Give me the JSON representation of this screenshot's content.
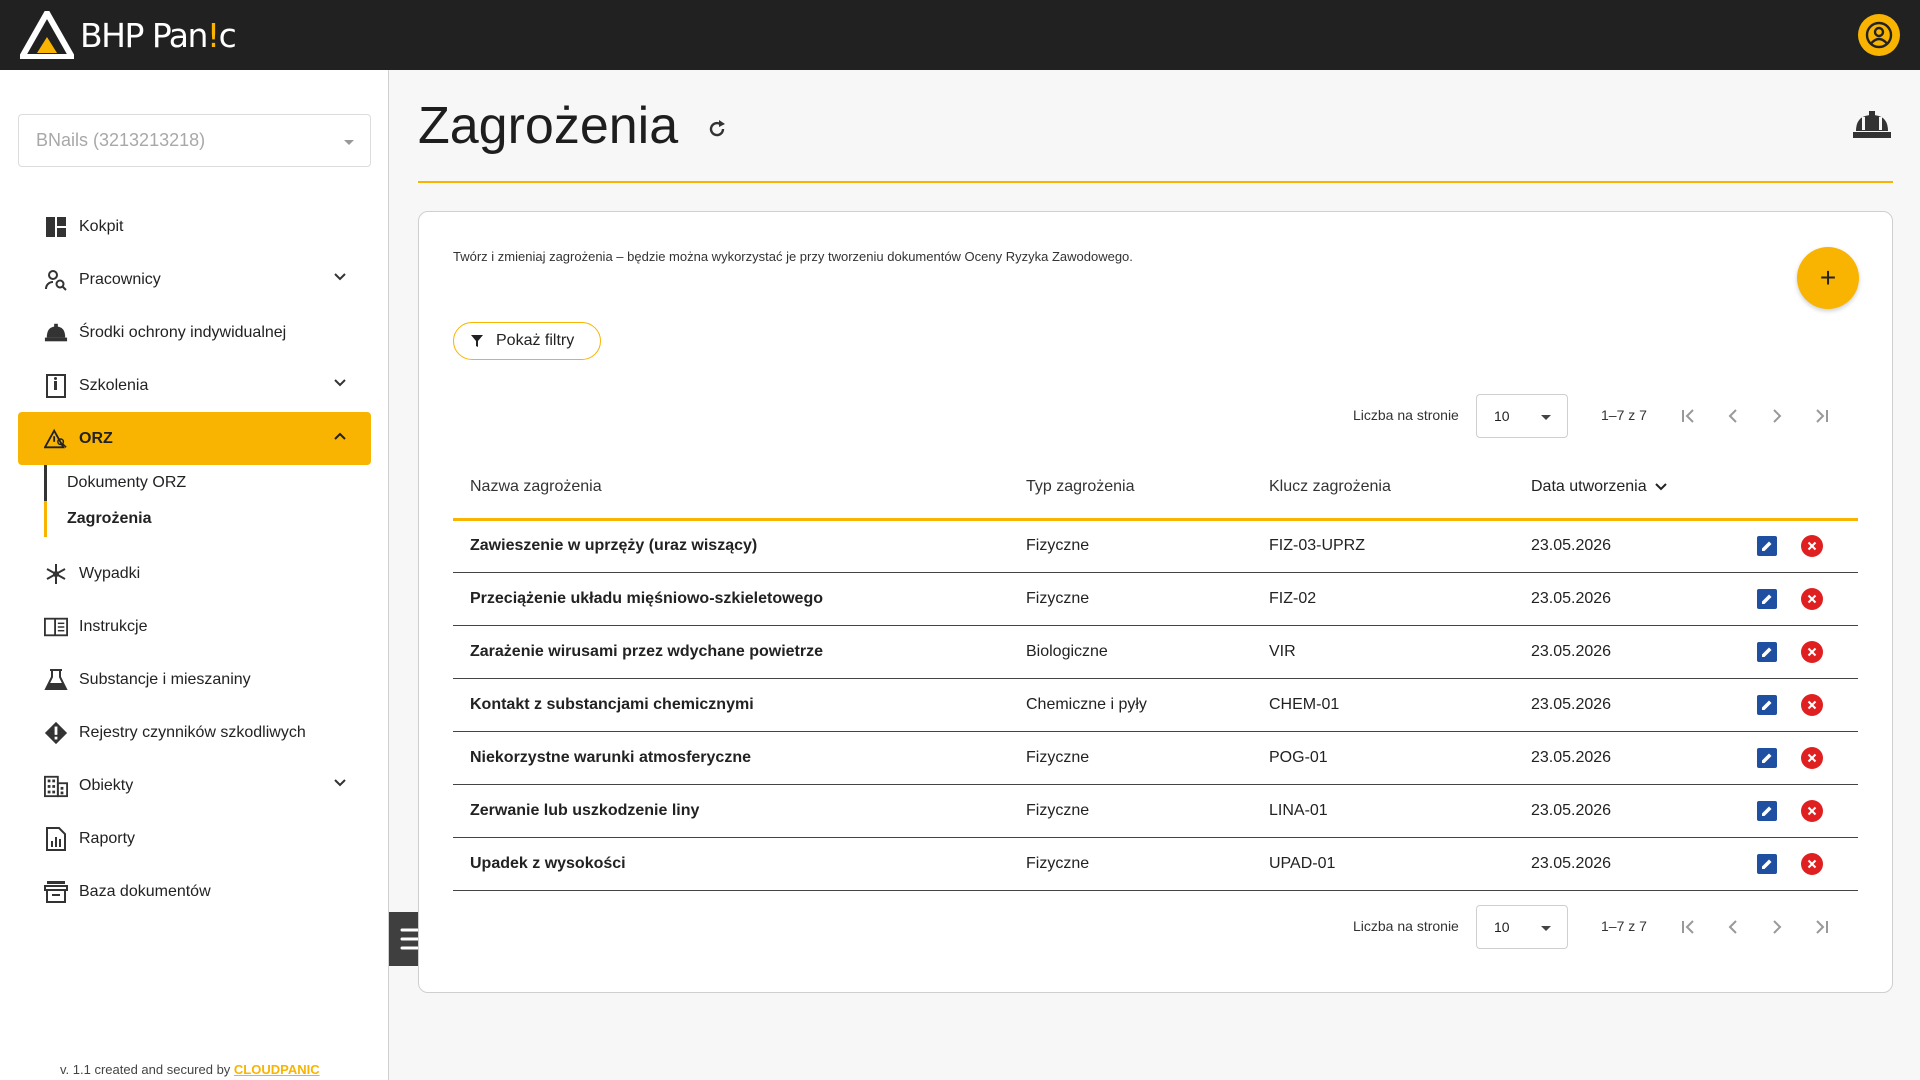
{
  "app": {
    "logo_main": "BHP Pan",
    "logo_accent": "!",
    "logo_end": "c"
  },
  "sidebar": {
    "company": "BNails (3213213218)",
    "items": [
      {
        "label": "Kokpit",
        "icon": "dashboard-icon"
      },
      {
        "label": "Pracownicy",
        "icon": "user-search-icon",
        "expandable": true
      },
      {
        "label": "Środki ochrony indywidualnej",
        "icon": "helmet-icon"
      },
      {
        "label": "Szkolenia",
        "icon": "training-icon",
        "expandable": true
      },
      {
        "label": "ORZ",
        "icon": "warning-icon",
        "expandable": true,
        "active": true
      },
      {
        "label": "Wypadki",
        "icon": "medical-icon"
      },
      {
        "label": "Instrukcje",
        "icon": "book-icon"
      },
      {
        "label": "Substancje i mieszaniny",
        "icon": "flask-icon"
      },
      {
        "label": "Rejestry czynników szkodliwych",
        "icon": "alert-diamond-icon"
      },
      {
        "label": "Obiekty",
        "icon": "building-icon",
        "expandable": true
      },
      {
        "label": "Raporty",
        "icon": "report-icon"
      },
      {
        "label": "Baza dokumentów",
        "icon": "archive-icon"
      }
    ],
    "orz_sub": [
      "Dokumenty ORZ",
      "Zagrożenia"
    ],
    "footer_prefix": "v. 1.1 created and secured by ",
    "footer_brand": "CLOUDPANIC"
  },
  "main": {
    "title": "Zagrożenia",
    "description": "Twórz i zmieniaj zagrożenia – będzie można wykorzystać je przy tworzeniu dokumentów Oceny Ryzyka Zawodowego.",
    "filter_label": "Pokaż filtry",
    "add_label": "+",
    "pager": {
      "per_page_label": "Liczba na stronie",
      "per_page": "10",
      "range": "1–7 z 7"
    },
    "columns": [
      "Nazwa zagrożenia",
      "Typ zagrożenia",
      "Klucz zagrożenia",
      "Data utworzenia"
    ],
    "rows": [
      [
        "Zawieszenie w uprzęży (uraz wiszący)",
        "Fizyczne",
        "FIZ-03-UPRZ",
        "23.05.2026"
      ],
      [
        "Przeciążenie układu mięśniowo-szkieletowego",
        "Fizyczne",
        "FIZ-02",
        "23.05.2026"
      ],
      [
        "Zarażenie wirusami przez wdychane powietrze",
        "Biologiczne",
        "VIR",
        "23.05.2026"
      ],
      [
        "Kontakt z substancjami chemicznymi",
        "Chemiczne i pyły",
        "CHEM-01",
        "23.05.2026"
      ],
      [
        "Niekorzystne warunki atmosferyczne",
        "Fizyczne",
        "POG-01",
        "23.05.2026"
      ],
      [
        "Zerwanie lub uszkodzenie liny",
        "Fizyczne",
        "LINA-01",
        "23.05.2026"
      ],
      [
        "Upadek z wysokości",
        "Fizyczne",
        "UPAD-01",
        "23.05.2026"
      ]
    ]
  },
  "colors": {
    "accent": "#f8b400",
    "topbar": "#212121",
    "edit": "#1f4fa0",
    "delete": "#e02020"
  }
}
